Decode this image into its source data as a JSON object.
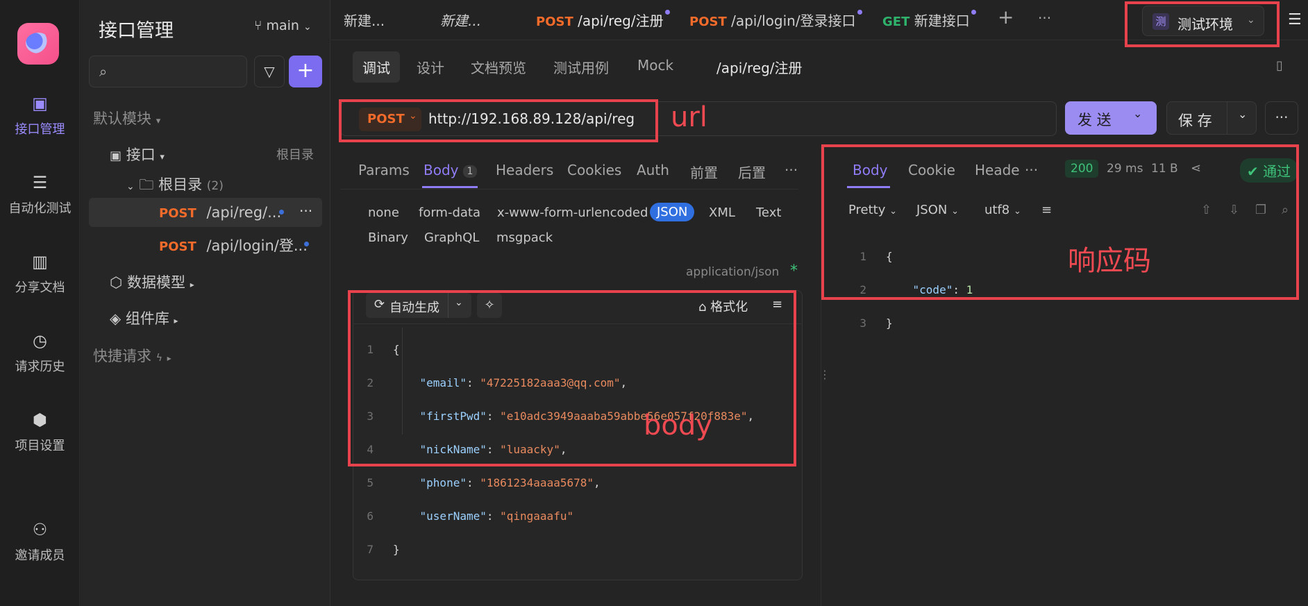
{
  "rail": {
    "items": [
      {
        "label": "接口管理",
        "icon": "api-icon"
      },
      {
        "label": "自动化测试",
        "icon": "automation-icon"
      },
      {
        "label": "分享文档",
        "icon": "book-icon"
      },
      {
        "label": "请求历史",
        "icon": "history-icon"
      },
      {
        "label": "项目设置",
        "icon": "settings-icon"
      },
      {
        "label": "邀请成员",
        "icon": "invite-icon"
      }
    ]
  },
  "sidebar": {
    "title": "接口管理",
    "branch": "main",
    "default_module": "默认模块",
    "api_node": "接口",
    "root_label": "根目录",
    "folder": "根目录",
    "folder_count": "(2)",
    "items": [
      {
        "method": "POST",
        "path": "/api/reg/..."
      },
      {
        "method": "POST",
        "path": "/api/login/登..."
      }
    ],
    "data_model": "数据模型",
    "components": "组件库",
    "quick_request": "快捷请求"
  },
  "tabs": {
    "items": [
      {
        "method": "",
        "label": "新建..."
      },
      {
        "method": "",
        "label": "新建..."
      },
      {
        "method": "POST",
        "label": "/api/reg/注册"
      },
      {
        "method": "POST",
        "label": "/api/login/登录接口"
      },
      {
        "method": "GET",
        "label": "新建接口"
      }
    ],
    "add": "+",
    "more": "···",
    "env_badge": "测",
    "env_label": "测试环境"
  },
  "subtabs": {
    "items": [
      "调试",
      "设计",
      "文档预览",
      "测试用例",
      "Mock"
    ],
    "path": "/api/reg/注册"
  },
  "request": {
    "method": "POST",
    "url": "http://192.168.89.128/api/reg",
    "send": "发 送",
    "save": "保 存"
  },
  "request_tabs": {
    "items": [
      "Params",
      "Body",
      "Headers",
      "Cookies",
      "Auth",
      "前置",
      "后置"
    ],
    "body_count": "1"
  },
  "body_types": [
    "none",
    "form-data",
    "x-www-form-urlencoded",
    "JSON",
    "XML",
    "Text",
    "Binary",
    "GraphQL",
    "msgpack"
  ],
  "content_type": "application/json",
  "required_mark": "*",
  "editor": {
    "auto_gen": "自动生成",
    "format": "格式化",
    "lines": [
      {
        "n": "1",
        "text": "{"
      },
      {
        "n": "2",
        "key": "\"email\"",
        "val": "\"47225182aaa3@qq.com\""
      },
      {
        "n": "3",
        "key": "\"firstPwd\"",
        "val": "\"e10adc3949aaaba59abbe56e057f20f883e\""
      },
      {
        "n": "4",
        "key": "\"nickName\"",
        "val": "\"luaacky\""
      },
      {
        "n": "5",
        "key": "\"phone\"",
        "val": "\"1861234aaaa5678\""
      },
      {
        "n": "6",
        "key": "\"userName\"",
        "val": "\"qingaaafu\""
      },
      {
        "n": "7",
        "text": "}"
      }
    ]
  },
  "response": {
    "tabs": [
      "Body",
      "Cookie",
      "Heade"
    ],
    "status": "200",
    "time": "29 ms",
    "size": "11 B",
    "pass": "通过",
    "format": "Pretty",
    "type": "JSON",
    "encoding": "utf8",
    "lines": [
      {
        "n": "1",
        "text": "{"
      },
      {
        "n": "2",
        "key": "\"code\"",
        "val": "1"
      },
      {
        "n": "3",
        "text": "}"
      }
    ]
  },
  "annotations": {
    "url": "url",
    "body": "body",
    "response_code": "响应码"
  }
}
